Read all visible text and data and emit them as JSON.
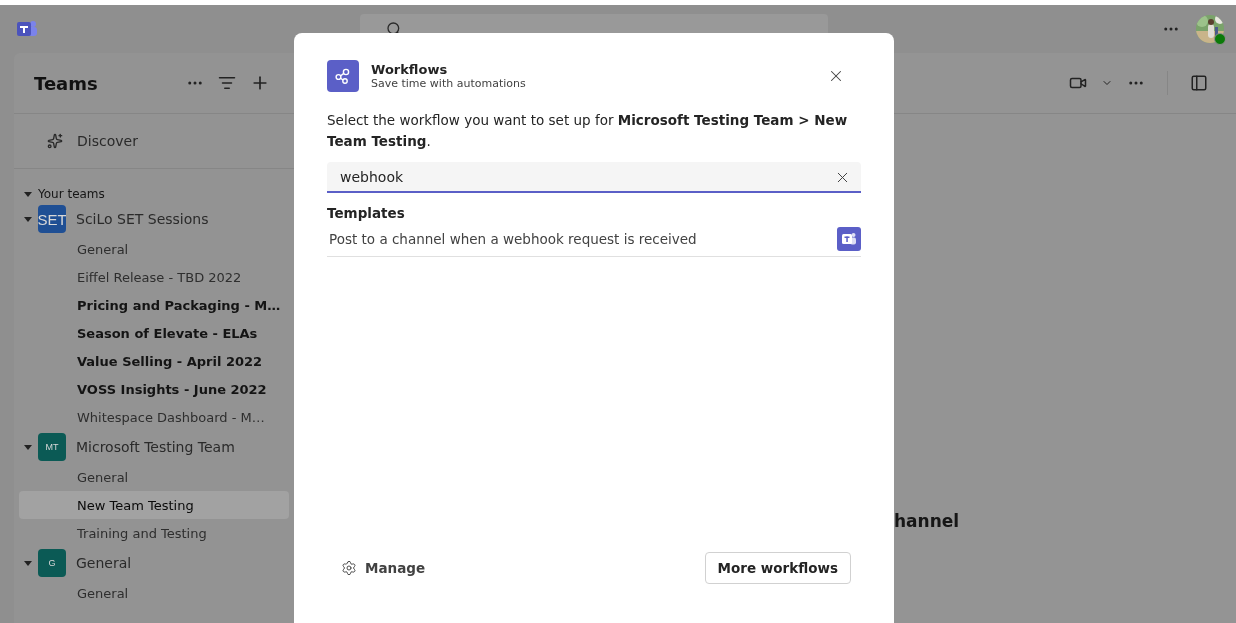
{
  "app_bar": {
    "search": {
      "kind": "field"
    }
  },
  "sidebar": {
    "title": "Teams",
    "discover": "Discover",
    "section": {
      "label": "Your teams",
      "expanded": true
    },
    "teams": [
      {
        "avatar": "SET",
        "name": "SciLo SET Sessions",
        "expanded": true,
        "color": "#1f4f94",
        "channels": [
          {
            "name": "General",
            "unread": false,
            "selected": false
          },
          {
            "name": "Eiffel Release - TBD 2022",
            "unread": false,
            "selected": false
          },
          {
            "name": "Pricing and Packaging - M…",
            "unread": true,
            "selected": false
          },
          {
            "name": "Season of Elevate - ELAs",
            "unread": true,
            "selected": false
          },
          {
            "name": "Value Selling - April 2022",
            "unread": true,
            "selected": false
          },
          {
            "name": "VOSS Insights - June 2022",
            "unread": true,
            "selected": false
          },
          {
            "name": "Whitespace Dashboard - M…",
            "unread": false,
            "selected": false
          }
        ]
      },
      {
        "avatar": "MT",
        "name": "Microsoft Testing Team",
        "expanded": true,
        "color": "#0b5a55",
        "channels": [
          {
            "name": "General",
            "unread": false,
            "selected": false
          },
          {
            "name": "New Team Testing",
            "unread": false,
            "selected": true
          },
          {
            "name": "Training and Testing",
            "unread": false,
            "selected": false
          }
        ]
      },
      {
        "avatar": "G",
        "name": "General",
        "expanded": true,
        "color": "#0b5a55",
        "channels": [
          {
            "name": "General",
            "unread": false,
            "selected": false
          }
        ]
      }
    ]
  },
  "main": {
    "heading": "hannel"
  },
  "dialog": {
    "title": "Workflows",
    "subtitle": "Save time with automations",
    "description": "Select the workflow you want to set up for **Microsoft Testing Team > New Team Testing**.",
    "search": {
      "value": "webhook"
    },
    "section": "Templates",
    "templates": [
      {
        "title": "Post to a channel when a webhook request is received"
      }
    ],
    "manage": "Manage",
    "more_button": "More workflows"
  }
}
